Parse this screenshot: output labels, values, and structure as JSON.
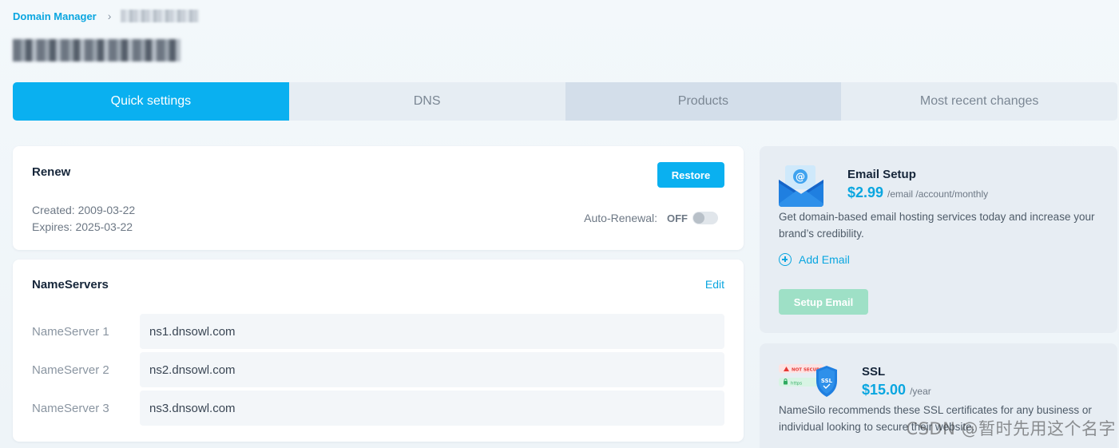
{
  "breadcrumb": {
    "root": "Domain Manager",
    "separator": "›"
  },
  "tabs": [
    {
      "label": "Quick settings",
      "active": true
    },
    {
      "label": "DNS"
    },
    {
      "label": "Products"
    },
    {
      "label": "Most recent changes"
    }
  ],
  "renew": {
    "title": "Renew",
    "created": "Created: 2009-03-22",
    "expires": "Expires: 2025-03-22",
    "restore_label": "Restore",
    "auto_renewal_label": "Auto-Renewal:",
    "auto_renewal_state": "OFF"
  },
  "nameservers": {
    "title": "NameServers",
    "edit_label": "Edit",
    "rows": [
      {
        "label": "NameServer 1",
        "value": "ns1.dnsowl.com"
      },
      {
        "label": "NameServer 2",
        "value": "ns2.dnsowl.com"
      },
      {
        "label": "NameServer 3",
        "value": "ns3.dnsowl.com"
      }
    ]
  },
  "email": {
    "title": "Email Setup",
    "price": "$2.99",
    "unit": "/email /account/monthly",
    "description": "Get domain-based email hosting services today and increase your brand’s credibility.",
    "add_label": "Add Email",
    "setup_label": "Setup Email",
    "icon_glyph": "@"
  },
  "ssl": {
    "title": "SSL",
    "price": "$15.00",
    "unit": "/year",
    "description": "NameSilo recommends these SSL certificates for any business or individual looking to secure their website.",
    "badge_not_secure": "NOT SECURE",
    "badge_https": "https",
    "shield_text": "SSL"
  },
  "watermark": "CSDN @暂时先用这个名字",
  "colors": {
    "accent": "#0ab0f0",
    "link": "#0aa6e0",
    "setup_btn": "#9ee0c6"
  }
}
